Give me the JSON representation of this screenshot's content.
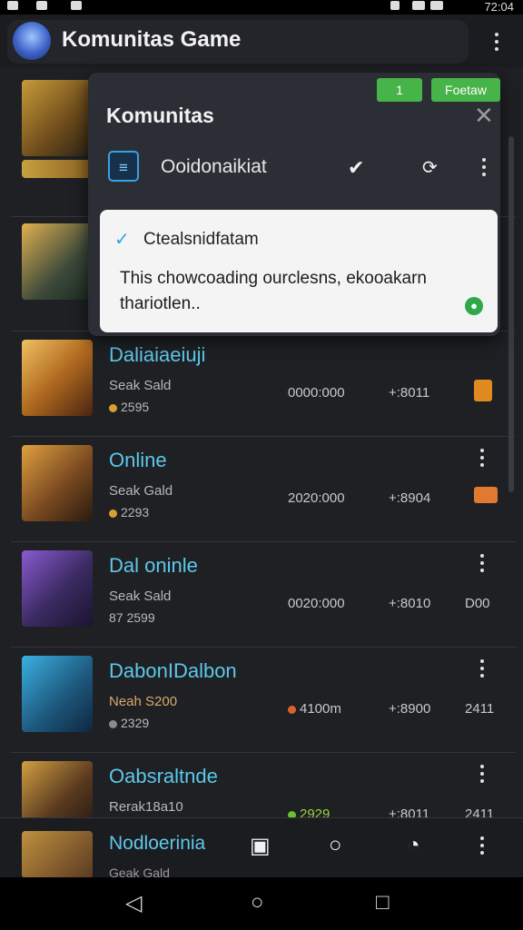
{
  "status_bar": {
    "time": "72:04"
  },
  "app_bar": {
    "title": "Komunitas Game"
  },
  "panel": {
    "title": "Komunitas",
    "badge_left": "1",
    "badge_right": "Foetaw",
    "option_label": "Ooidonaikiat",
    "card": {
      "title": "Ctealsnidfatam",
      "body": "This chowcoading ourclesns, ekooakarn thariotlen.."
    }
  },
  "rows": [
    {
      "name": "Daliaiaeiuji",
      "sub": "Seak Sald",
      "sub2": "2595",
      "col1": "0000:000",
      "col2": "+:8011",
      "col3": ""
    },
    {
      "name": "Online",
      "sub": "Seak Gald",
      "sub2": "2293",
      "col1": "2020:000",
      "col2": "+:8904",
      "col3": ""
    },
    {
      "name": "Dal oninle",
      "sub": "Seak Sald",
      "sub2": "87 2599",
      "col1": "0020:000",
      "col2": "+:8010",
      "col3": "D00"
    },
    {
      "name": "DabonIDalbon",
      "sub": "Neah S200",
      "sub2": "2329",
      "col1": "4100m",
      "col2": "+:8900",
      "col3": "2411"
    },
    {
      "name": "Oabsraltnde",
      "sub": "Rerak18a10",
      "sub2": "",
      "col1": "2929",
      "col2": "+:8011",
      "col3": "2411"
    }
  ],
  "bottom_bar": {
    "name": "Nodloerinia",
    "sub": "Geak Gald"
  },
  "colors": {
    "accent": "#5dc8ea",
    "panel_bg": "#2b2e34",
    "green": "#46b448"
  },
  "icons": {
    "nav_back": "back-icon",
    "nav_home": "home-icon",
    "nav_recent": "recent-icon"
  }
}
